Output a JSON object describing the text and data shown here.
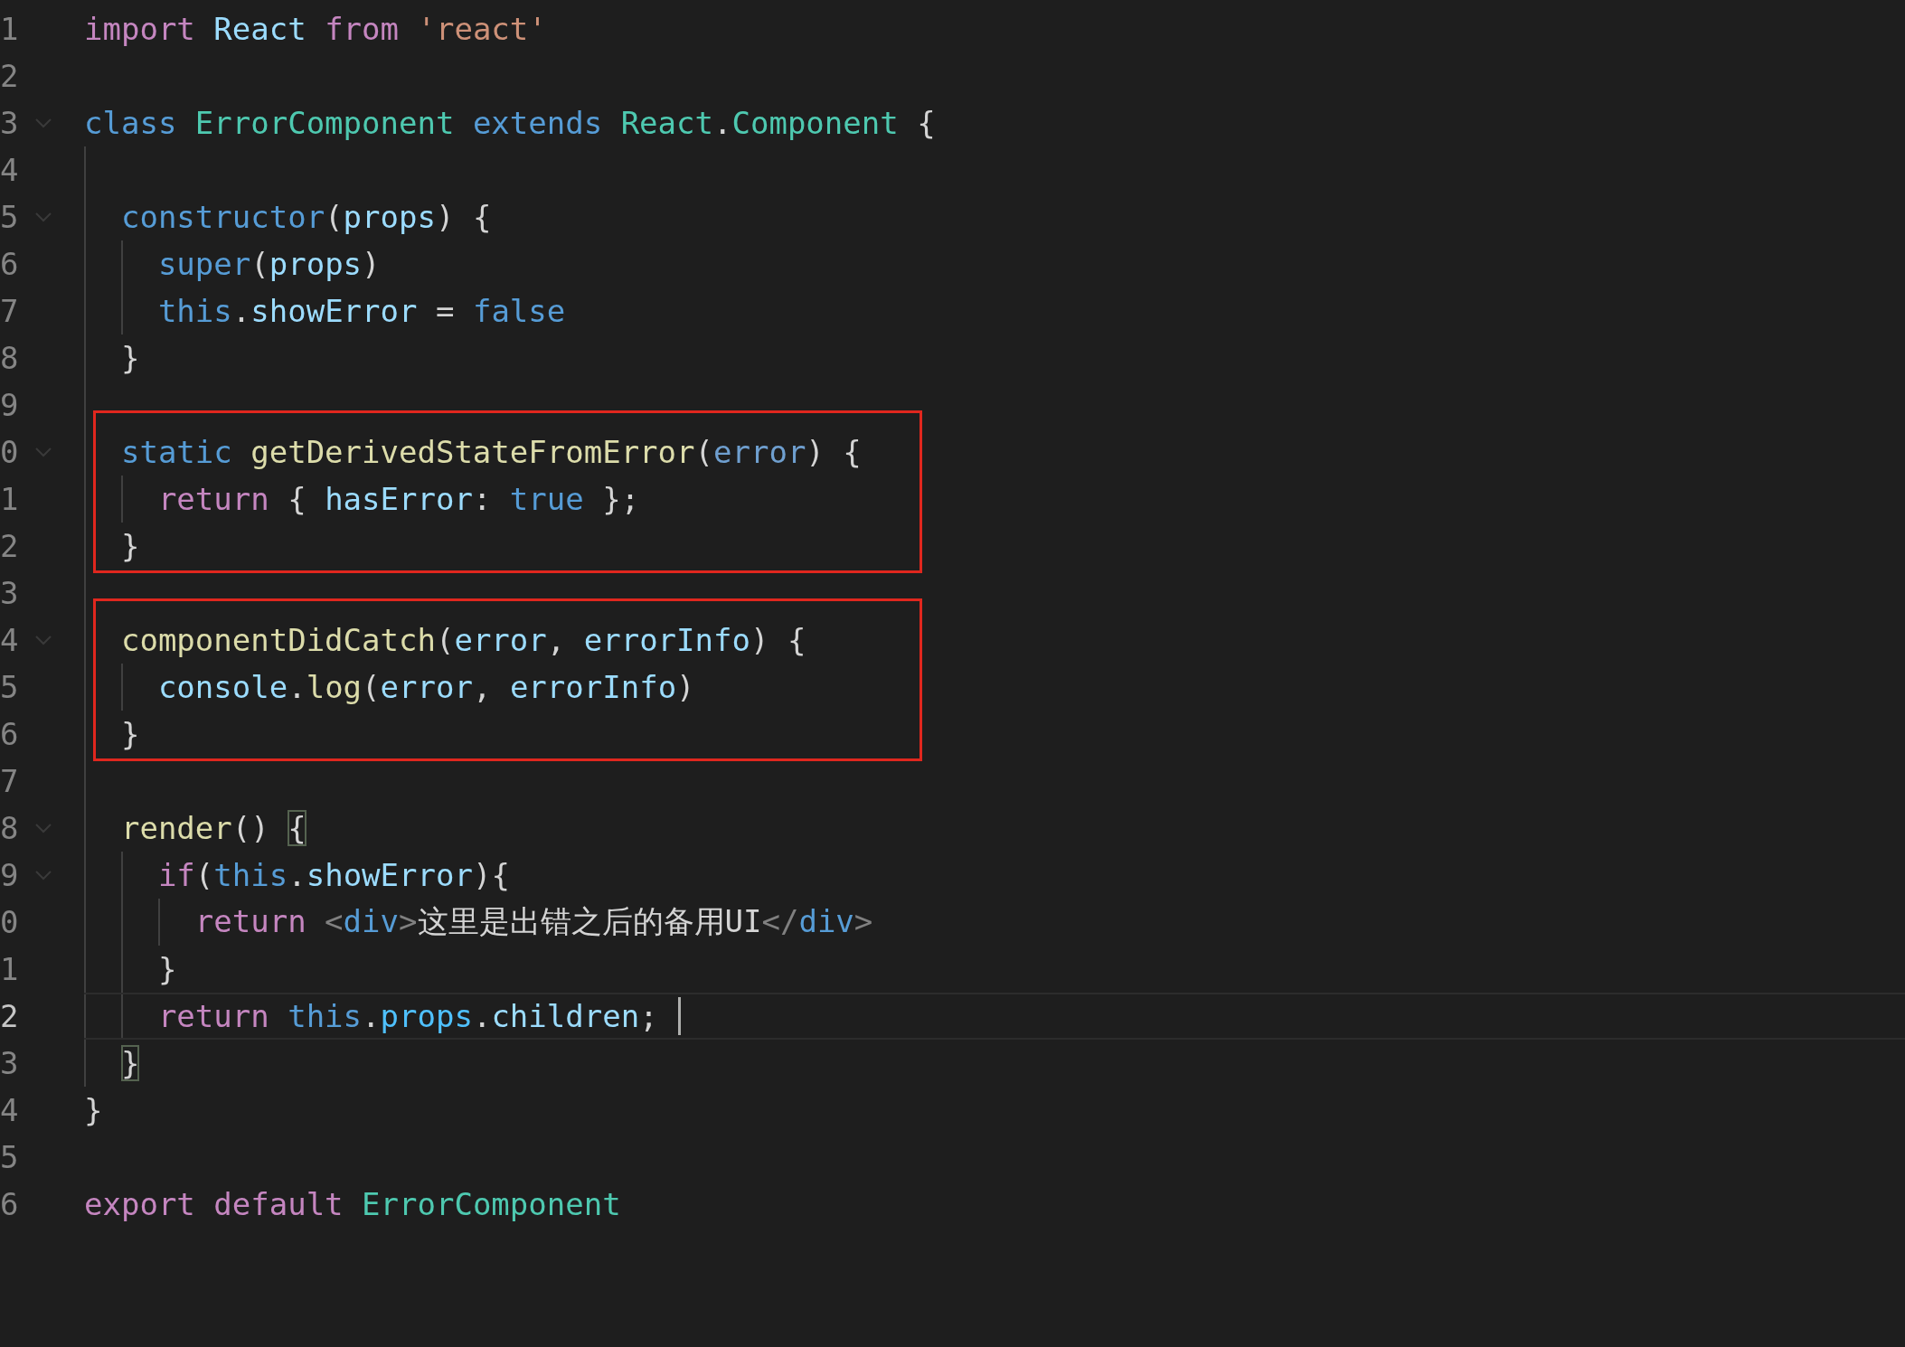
{
  "editor": {
    "blocks": [
      {
        "boxed": false,
        "lines": [
          {
            "number": "1",
            "fold": false,
            "current": false,
            "tokens": [
              {
                "text": "import ",
                "kind": "keyword"
              },
              {
                "text": "React ",
                "kind": "variable"
              },
              {
                "text": "from ",
                "kind": "keyword"
              },
              {
                "text": "'react'",
                "kind": "string"
              }
            ]
          },
          {
            "number": "2",
            "fold": false,
            "current": false
          },
          {
            "number": "3",
            "fold": true,
            "current": false,
            "tokens": [
              {
                "text": "class ",
                "kind": "storage"
              },
              {
                "text": "ErrorComponent ",
                "kind": "class"
              },
              {
                "text": "extends ",
                "kind": "storage"
              },
              {
                "text": "React",
                "kind": "class"
              },
              {
                "text": ".",
                "kind": "plain"
              },
              {
                "text": "Component",
                "kind": "class"
              },
              {
                "text": " {",
                "kind": "plain"
              }
            ]
          },
          {
            "number": "4",
            "fold": false,
            "current": false
          },
          {
            "number": "5",
            "fold": true,
            "current": false,
            "tokens": [
              {
                "text": "  constructor",
                "kind": "storage"
              },
              {
                "text": "(",
                "kind": "plain"
              },
              {
                "text": "props",
                "kind": "variable"
              },
              {
                "text": ") {",
                "kind": "plain"
              }
            ]
          },
          {
            "number": "6",
            "fold": false,
            "current": false,
            "tokens": [
              {
                "text": "    super",
                "kind": "storage"
              },
              {
                "text": "(",
                "kind": "plain"
              },
              {
                "text": "props",
                "kind": "variable"
              },
              {
                "text": ")",
                "kind": "plain"
              }
            ]
          },
          {
            "number": "7",
            "fold": false,
            "current": false,
            "tokens": [
              {
                "text": "    this",
                "kind": "storage"
              },
              {
                "text": ".",
                "kind": "plain"
              },
              {
                "text": "showError",
                "kind": "variable"
              },
              {
                "text": " = ",
                "kind": "plain"
              },
              {
                "text": "false",
                "kind": "storage"
              }
            ]
          },
          {
            "number": "8",
            "fold": false,
            "current": false,
            "tokens": [
              {
                "text": "  }",
                "kind": "plain"
              }
            ]
          },
          {
            "number": "9",
            "fold": false,
            "current": false
          }
        ]
      },
      {
        "boxed": true,
        "lines": [
          {
            "number": "0",
            "fold": true,
            "current": false,
            "tokens": [
              {
                "text": "  static ",
                "kind": "storage"
              },
              {
                "text": "getDerivedStateFromError",
                "kind": "function"
              },
              {
                "text": "(",
                "kind": "plain"
              },
              {
                "text": "error",
                "kind": "dim"
              },
              {
                "text": ") {",
                "kind": "plain"
              }
            ]
          },
          {
            "number": "1",
            "fold": false,
            "current": false,
            "tokens": [
              {
                "text": "    return ",
                "kind": "keyword"
              },
              {
                "text": "{ ",
                "kind": "plain"
              },
              {
                "text": "hasError",
                "kind": "variable"
              },
              {
                "text": ": ",
                "kind": "plain"
              },
              {
                "text": "true",
                "kind": "storage"
              },
              {
                "text": " };",
                "kind": "plain"
              }
            ]
          },
          {
            "number": "2",
            "fold": false,
            "current": false,
            "tokens": [
              {
                "text": "  }",
                "kind": "plain"
              }
            ]
          }
        ]
      },
      {
        "boxed": false,
        "lines": [
          {
            "number": "3",
            "fold": false,
            "current": false
          }
        ]
      },
      {
        "boxed": true,
        "lines": [
          {
            "number": "4",
            "fold": true,
            "current": false,
            "tokens": [
              {
                "text": "  componentDidCatch",
                "kind": "function"
              },
              {
                "text": "(",
                "kind": "plain"
              },
              {
                "text": "error",
                "kind": "variable"
              },
              {
                "text": ", ",
                "kind": "plain"
              },
              {
                "text": "errorInfo",
                "kind": "variable"
              },
              {
                "text": ") {",
                "kind": "plain"
              }
            ]
          },
          {
            "number": "5",
            "fold": false,
            "current": false,
            "tokens": [
              {
                "text": "    console",
                "kind": "variable"
              },
              {
                "text": ".",
                "kind": "plain"
              },
              {
                "text": "log",
                "kind": "function"
              },
              {
                "text": "(",
                "kind": "plain"
              },
              {
                "text": "error",
                "kind": "variable"
              },
              {
                "text": ", ",
                "kind": "plain"
              },
              {
                "text": "errorInfo",
                "kind": "variable"
              },
              {
                "text": ")",
                "kind": "plain"
              }
            ]
          },
          {
            "number": "6",
            "fold": false,
            "current": false,
            "tokens": [
              {
                "text": "  }",
                "kind": "plain"
              }
            ]
          }
        ]
      },
      {
        "boxed": false,
        "lines": [
          {
            "number": "7",
            "fold": false,
            "current": false
          },
          {
            "number": "8",
            "fold": true,
            "current": false,
            "tokens": [
              {
                "text": "  render",
                "kind": "function"
              },
              {
                "text": "() ",
                "kind": "plain"
              },
              {
                "text": "{",
                "kind": "bracket"
              }
            ]
          },
          {
            "number": "9",
            "fold": true,
            "current": false,
            "tokens": [
              {
                "text": "    if",
                "kind": "keyword"
              },
              {
                "text": "(",
                "kind": "plain"
              },
              {
                "text": "this",
                "kind": "storage"
              },
              {
                "text": ".",
                "kind": "plain"
              },
              {
                "text": "showError",
                "kind": "variable"
              },
              {
                "text": "){",
                "kind": "plain"
              }
            ]
          },
          {
            "number": "0",
            "fold": false,
            "current": false,
            "tokens": [
              {
                "text": "      return ",
                "kind": "keyword"
              },
              {
                "text": "<",
                "kind": "tag-punct"
              },
              {
                "text": "div",
                "kind": "tag"
              },
              {
                "text": ">",
                "kind": "tag-punct"
              },
              {
                "text": "这里是出错之后的备用UI",
                "kind": "plain"
              },
              {
                "text": "</",
                "kind": "tag-punct"
              },
              {
                "text": "div",
                "kind": "tag"
              },
              {
                "text": ">",
                "kind": "tag-punct"
              }
            ]
          },
          {
            "number": "1",
            "fold": false,
            "current": false,
            "tokens": [
              {
                "text": "    }",
                "kind": "plain"
              }
            ]
          },
          {
            "number": "2",
            "fold": false,
            "current": true,
            "tokens": [
              {
                "text": "    return ",
                "kind": "keyword"
              },
              {
                "text": "this",
                "kind": "storage"
              },
              {
                "text": ".",
                "kind": "plain"
              },
              {
                "text": "props",
                "kind": "constant"
              },
              {
                "text": ".",
                "kind": "plain"
              },
              {
                "text": "children",
                "kind": "variable"
              },
              {
                "text": "; ",
                "kind": "plain"
              }
            ]
          },
          {
            "number": "3",
            "fold": false,
            "current": false,
            "tokens": [
              {
                "text": "  }",
                "kind": "bracket"
              }
            ]
          },
          {
            "number": "4",
            "fold": false,
            "current": false,
            "tokens": [
              {
                "text": "}",
                "kind": "plain"
              }
            ]
          },
          {
            "number": "5",
            "fold": false,
            "current": false
          },
          {
            "number": "6",
            "fold": false,
            "current": false,
            "tokens": [
              {
                "text": "export ",
                "kind": "keyword"
              },
              {
                "text": "default ",
                "kind": "keyword"
              },
              {
                "text": "ErrorComponent",
                "kind": "class"
              }
            ]
          }
        ]
      }
    ]
  }
}
